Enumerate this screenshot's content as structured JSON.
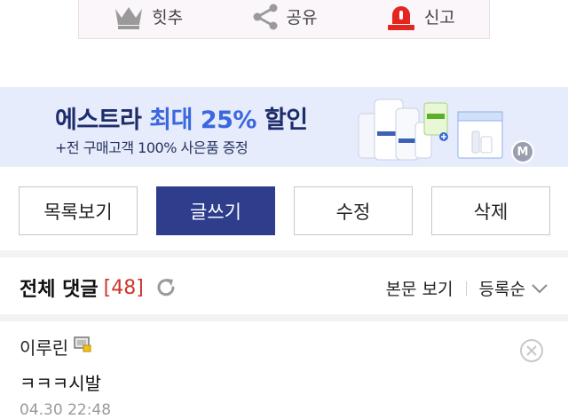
{
  "actions": [
    {
      "label": "힛추",
      "icon": "crown-icon"
    },
    {
      "label": "공유",
      "icon": "share-icon"
    },
    {
      "label": "신고",
      "icon": "siren-icon"
    }
  ],
  "banner": {
    "title_prefix": "에스트라 ",
    "title_highlight": "최대 25%",
    "title_suffix": " 할인",
    "subtitle": "+전 구매고객 100% 사은품 증정",
    "badge": "M",
    "accent_color": "#3b67df"
  },
  "buttons": {
    "list": "목록보기",
    "write": "글쓰기",
    "edit": "수정",
    "delete": "삭제"
  },
  "comments": {
    "title": "전체 댓글",
    "count": "[48]",
    "view_original": "본문 보기",
    "sort": "등록순"
  },
  "comment": {
    "author": "이루린",
    "body": "ㅋㅋㅋ시발",
    "time": "04.30 22:48"
  }
}
